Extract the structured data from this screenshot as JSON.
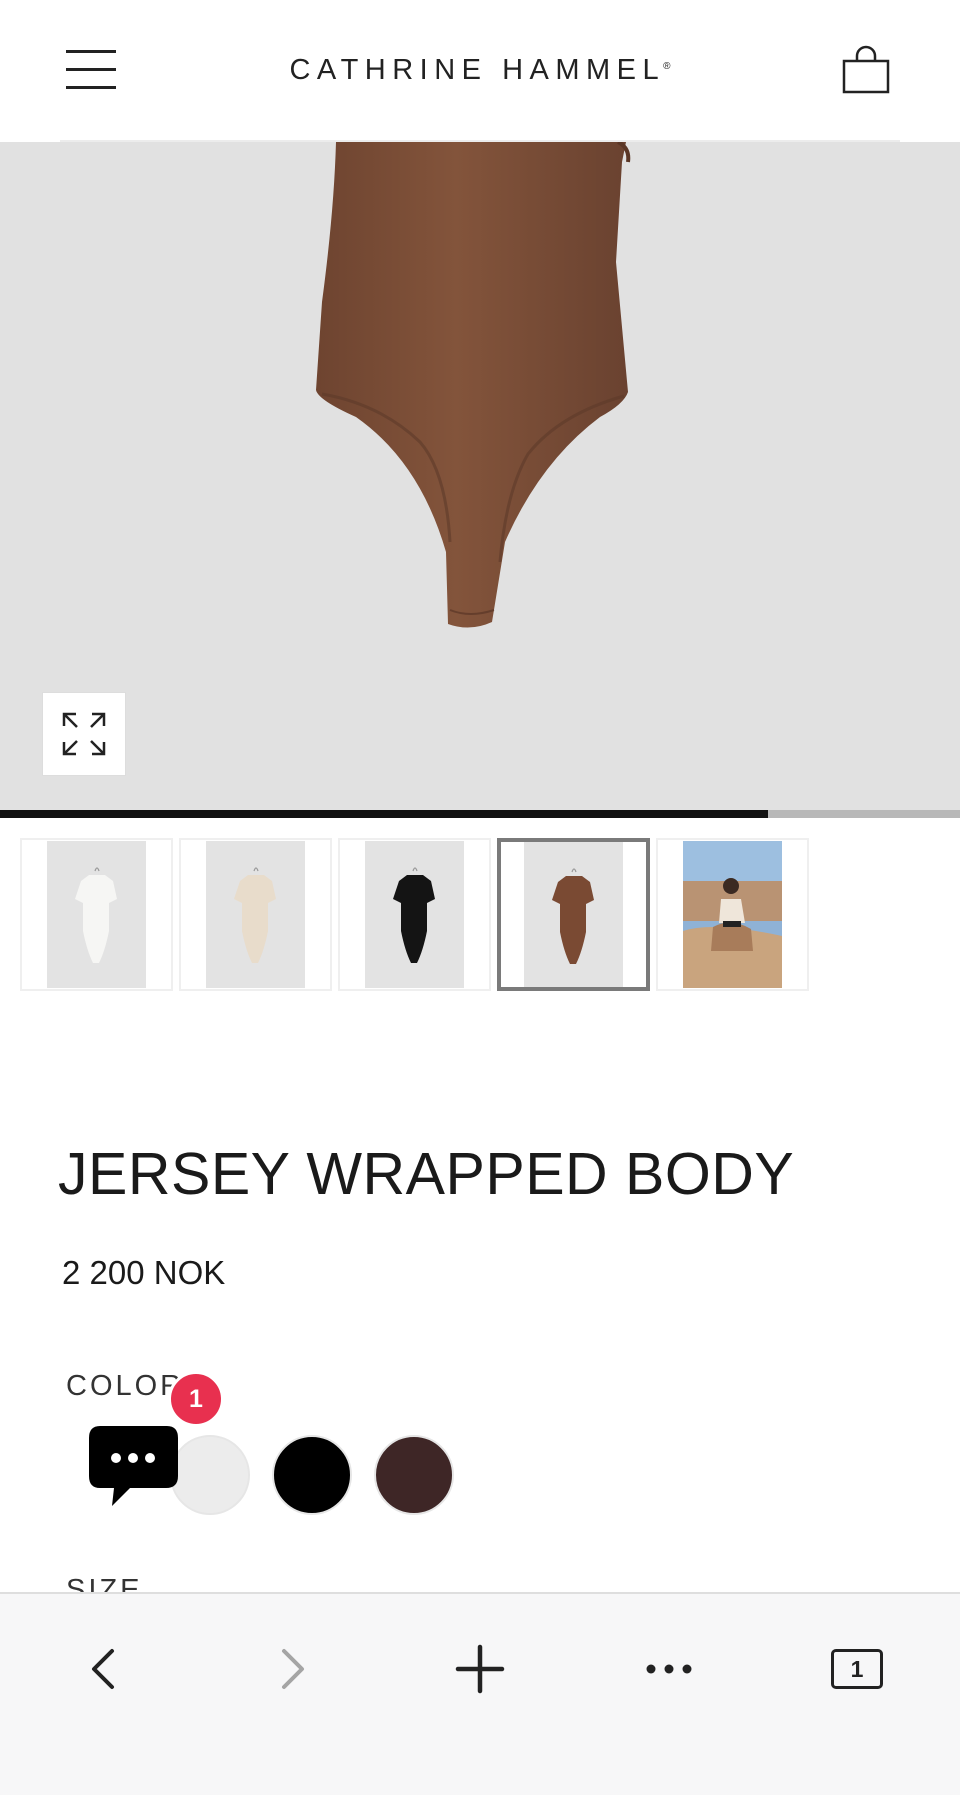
{
  "header": {
    "brand": "CATHRINE HAMMEL",
    "brand_mark": "®",
    "menu_icon": "hamburger-menu-icon",
    "bag_icon": "shopping-bag-icon"
  },
  "gallery": {
    "expand_icon": "expand-arrows-icon",
    "progress": 0.8,
    "thumbnails": [
      {
        "name": "thumbnail-white",
        "color": "#f6f6f4"
      },
      {
        "name": "thumbnail-cream",
        "color": "#e8dccb"
      },
      {
        "name": "thumbnail-black",
        "color": "#141414"
      },
      {
        "name": "thumbnail-brown",
        "color": "#7a4a33",
        "active": true
      },
      {
        "name": "thumbnail-lifestyle",
        "color": "#c9a47e"
      }
    ]
  },
  "product": {
    "title": "JERSEY WRAPPED BODY",
    "price": "2 200 NOK",
    "color_label": "COLOR",
    "size_label": "SIZE",
    "swatches": [
      {
        "name": "swatch-off-white",
        "color": "#ececec"
      },
      {
        "name": "swatch-black",
        "color": "#000000"
      },
      {
        "name": "swatch-dark-brown",
        "color": "#3e2626"
      }
    ]
  },
  "chat": {
    "icon": "chat-bubble-icon",
    "badge_count": "1"
  },
  "browser_toolbar": {
    "back_icon": "chevron-left-icon",
    "forward_icon": "chevron-right-icon",
    "new_tab_icon": "plus-icon",
    "more_icon": "more-dots-icon",
    "tab_count": "1"
  }
}
